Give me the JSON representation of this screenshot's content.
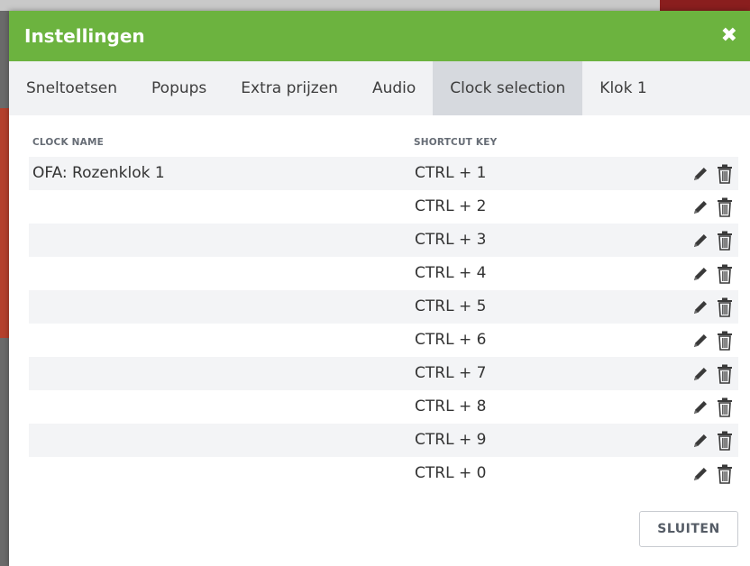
{
  "dialog": {
    "title": "Instellingen",
    "close_icon": "close-icon"
  },
  "tabs": [
    {
      "label": "Sneltoetsen",
      "active": false
    },
    {
      "label": "Popups",
      "active": false
    },
    {
      "label": "Extra prijzen",
      "active": false
    },
    {
      "label": "Audio",
      "active": false
    },
    {
      "label": "Clock selection",
      "active": true
    },
    {
      "label": "Klok 1",
      "active": false
    }
  ],
  "table": {
    "headers": {
      "name": "CLOCK NAME",
      "key": "SHORTCUT KEY"
    },
    "rows": [
      {
        "name": "OFA: Rozenklok 1",
        "key": "CTRL + 1"
      },
      {
        "name": "",
        "key": "CTRL + 2"
      },
      {
        "name": "",
        "key": "CTRL + 3"
      },
      {
        "name": "",
        "key": "CTRL + 4"
      },
      {
        "name": "",
        "key": "CTRL + 5"
      },
      {
        "name": "",
        "key": "CTRL + 6"
      },
      {
        "name": "",
        "key": "CTRL + 7"
      },
      {
        "name": "",
        "key": "CTRL + 8"
      },
      {
        "name": "",
        "key": "CTRL + 9"
      },
      {
        "name": "",
        "key": "CTRL + 0"
      }
    ],
    "row_icons": [
      "pencil-icon",
      "trash-icon"
    ]
  },
  "footer": {
    "close_label": "SLUITEN"
  },
  "colors": {
    "header": "#6cb33f",
    "tab_active": "#d6d9de",
    "icon": "#3a3a3a"
  }
}
